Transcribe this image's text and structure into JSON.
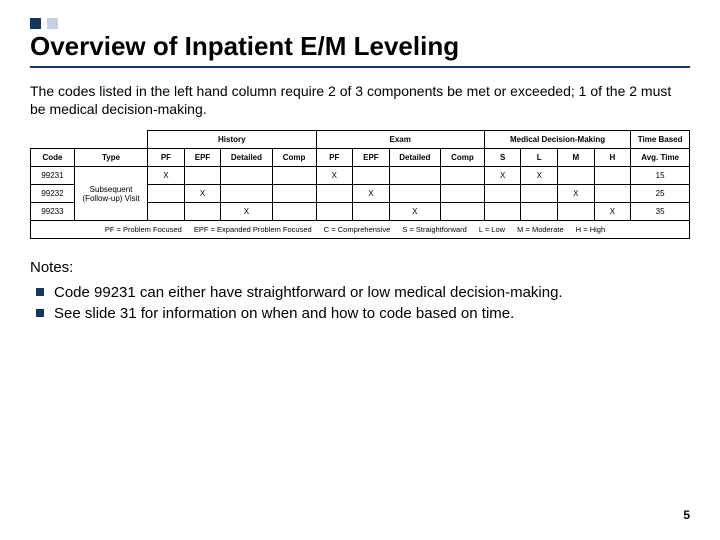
{
  "title": "Overview of Inpatient E/M Leveling",
  "intro": "The codes listed in the left hand column require 2 of 3 components be met or exceeded; 1 of the 2 must be medical decision-making.",
  "groupHeaders": {
    "history": "History",
    "exam": "Exam",
    "mdm": "Medical Decision-Making",
    "time": "Time Based"
  },
  "cols": {
    "code": "Code",
    "type": "Type",
    "pf": "PF",
    "epf": "EPF",
    "detailed": "Detailed",
    "comp": "Comp",
    "s": "S",
    "l": "L",
    "m": "M",
    "h": "H",
    "avg": "Avg. Time"
  },
  "type_label": "Subsequent (Follow-up) Visit",
  "rows": [
    {
      "code": "99231",
      "h_pf": "X",
      "h_epf": "",
      "h_det": "",
      "h_comp": "",
      "e_pf": "X",
      "e_epf": "",
      "e_det": "",
      "e_comp": "",
      "s": "X",
      "l": "X",
      "m": "",
      "h": "",
      "avg": "15"
    },
    {
      "code": "99232",
      "h_pf": "",
      "h_epf": "X",
      "h_det": "",
      "h_comp": "",
      "e_pf": "",
      "e_epf": "X",
      "e_det": "",
      "e_comp": "",
      "s": "",
      "l": "",
      "m": "X",
      "h": "",
      "avg": "25"
    },
    {
      "code": "99233",
      "h_pf": "",
      "h_epf": "",
      "h_det": "X",
      "h_comp": "",
      "e_pf": "",
      "e_epf": "",
      "e_det": "X",
      "e_comp": "",
      "s": "",
      "l": "",
      "m": "",
      "h": "X",
      "avg": "35"
    }
  ],
  "legend": {
    "pf": "PF = Problem Focused",
    "epf": "EPF = Expanded Problem Focused",
    "c": "C = Comprehensive",
    "s": "S = Straightforward",
    "l": "L = Low",
    "m": "M = Moderate",
    "h": "H = High"
  },
  "notes_heading": "Notes:",
  "notes": [
    "Code 99231 can either have straightforward or low medical decision-making.",
    "See slide 31 for information on when and how to code based on time."
  ],
  "page": "5"
}
